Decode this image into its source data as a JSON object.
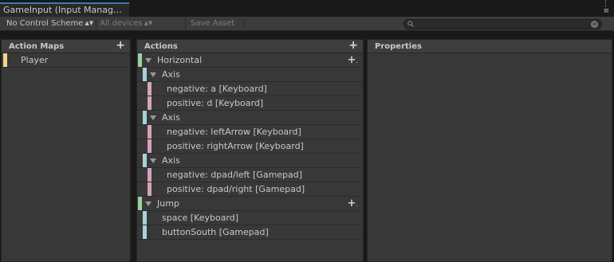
{
  "window": {
    "tab_title": "GameInput (Input Manag…"
  },
  "toolbar": {
    "control_scheme": "No Control Scheme",
    "devices": "All devices",
    "save_asset": "Save Asset",
    "search_placeholder": ""
  },
  "panels": {
    "action_maps_title": "Action Maps",
    "actions_title": "Actions",
    "properties_title": "Properties"
  },
  "action_maps": [
    {
      "label": "Player",
      "color": "#f0d785"
    }
  ],
  "actions": [
    {
      "label": "Horizontal",
      "kind": "action",
      "color": "#9ed19e"
    },
    {
      "label": "Axis",
      "kind": "composite",
      "color": "#a7d3d9"
    },
    {
      "label": "negative: a [Keyboard]",
      "kind": "binding",
      "color": "#d4a5b8"
    },
    {
      "label": "positive: d [Keyboard]",
      "kind": "binding",
      "color": "#d4a5b8"
    },
    {
      "label": "Axis",
      "kind": "composite",
      "color": "#a7d3d9"
    },
    {
      "label": "negative: leftArrow [Keyboard]",
      "kind": "binding",
      "color": "#d4a5b8"
    },
    {
      "label": "positive: rightArrow [Keyboard]",
      "kind": "binding",
      "color": "#d4a5b8"
    },
    {
      "label": "Axis",
      "kind": "composite",
      "color": "#a7d3d9"
    },
    {
      "label": "negative: dpad/left [Gamepad]",
      "kind": "binding",
      "color": "#d4a5b8"
    },
    {
      "label": "positive: dpad/right [Gamepad]",
      "kind": "binding",
      "color": "#d4a5b8"
    },
    {
      "label": "Jump",
      "kind": "action",
      "color": "#9ed19e"
    },
    {
      "label": "space [Keyboard]",
      "kind": "simple",
      "color": "#a7d3d9"
    },
    {
      "label": "buttonSouth [Gamepad]",
      "kind": "simple",
      "color": "#a7d3d9"
    }
  ]
}
